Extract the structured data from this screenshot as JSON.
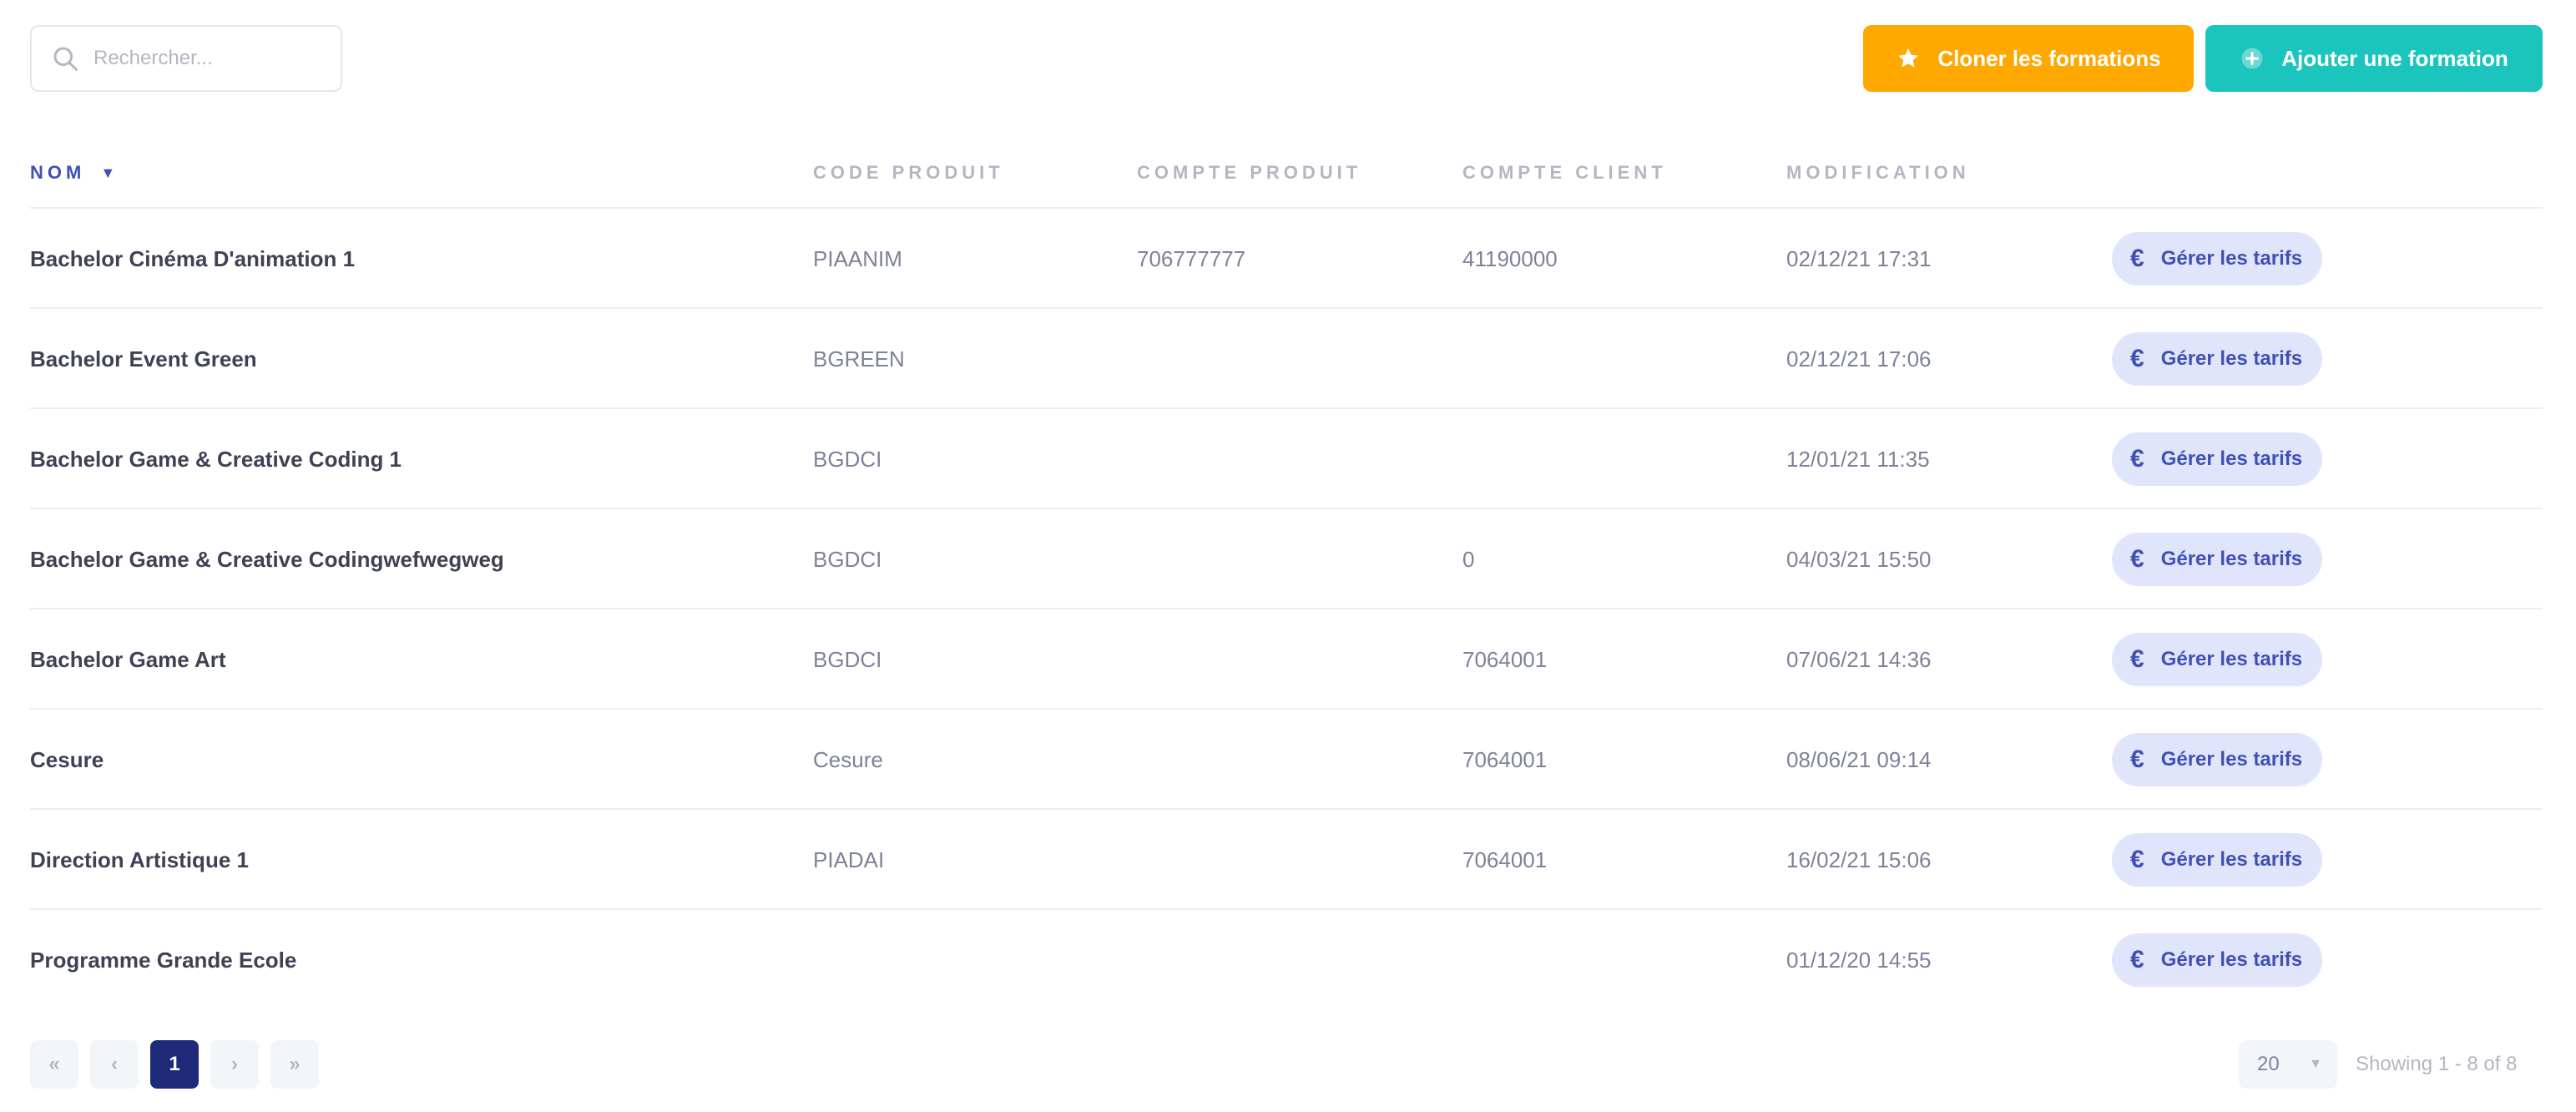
{
  "search": {
    "placeholder": "Rechercher..."
  },
  "actions": {
    "clone_label": "Cloner les formations",
    "add_label": "Ajouter une formation",
    "clone_color": "#ffa800",
    "add_color": "#1bc5bd"
  },
  "table": {
    "columns": [
      {
        "label": "NOM",
        "sorted": true,
        "sort_icon": "caret-down-icon"
      },
      {
        "label": "CODE PRODUIT"
      },
      {
        "label": "COMPTE PRODUIT"
      },
      {
        "label": "COMPTE CLIENT"
      },
      {
        "label": "MODIFICATION"
      }
    ],
    "action_label": "Gérer les tarifs",
    "action_icon": "euro-icon",
    "rows": [
      {
        "nom": "Bachelor Cinéma D'animation 1",
        "code": "PIAANIM",
        "compte_produit": "706777777",
        "compte_client": "41190000",
        "modification": "02/12/21 17:31"
      },
      {
        "nom": "Bachelor Event Green",
        "code": "BGREEN",
        "compte_produit": "",
        "compte_client": "",
        "modification": "02/12/21 17:06"
      },
      {
        "nom": "Bachelor Game & Creative Coding 1",
        "code": "BGDCI",
        "compte_produit": "",
        "compte_client": "",
        "modification": "12/01/21 11:35"
      },
      {
        "nom": "Bachelor Game & Creative Codingwefwegweg",
        "code": "BGDCI",
        "compte_produit": "",
        "compte_client": "0",
        "modification": "04/03/21 15:50"
      },
      {
        "nom": "Bachelor Game Art",
        "code": "BGDCI",
        "compte_produit": "",
        "compte_client": "7064001",
        "modification": "07/06/21 14:36"
      },
      {
        "nom": "Cesure",
        "code": "Cesure",
        "compte_produit": "",
        "compte_client": "7064001",
        "modification": "08/06/21 09:14"
      },
      {
        "nom": "Direction Artistique 1",
        "code": "PIADAI",
        "compte_produit": "",
        "compte_client": "7064001",
        "modification": "16/02/21 15:06"
      },
      {
        "nom": "Programme Grande Ecole",
        "code": "",
        "compte_produit": "",
        "compte_client": "",
        "modification": "01/12/20 14:55"
      }
    ]
  },
  "pagination": {
    "first": "«",
    "prev": "‹",
    "current": "1",
    "next": "›",
    "last": "»",
    "per_page": "20",
    "showing": "Showing 1 - 8 of 8"
  }
}
